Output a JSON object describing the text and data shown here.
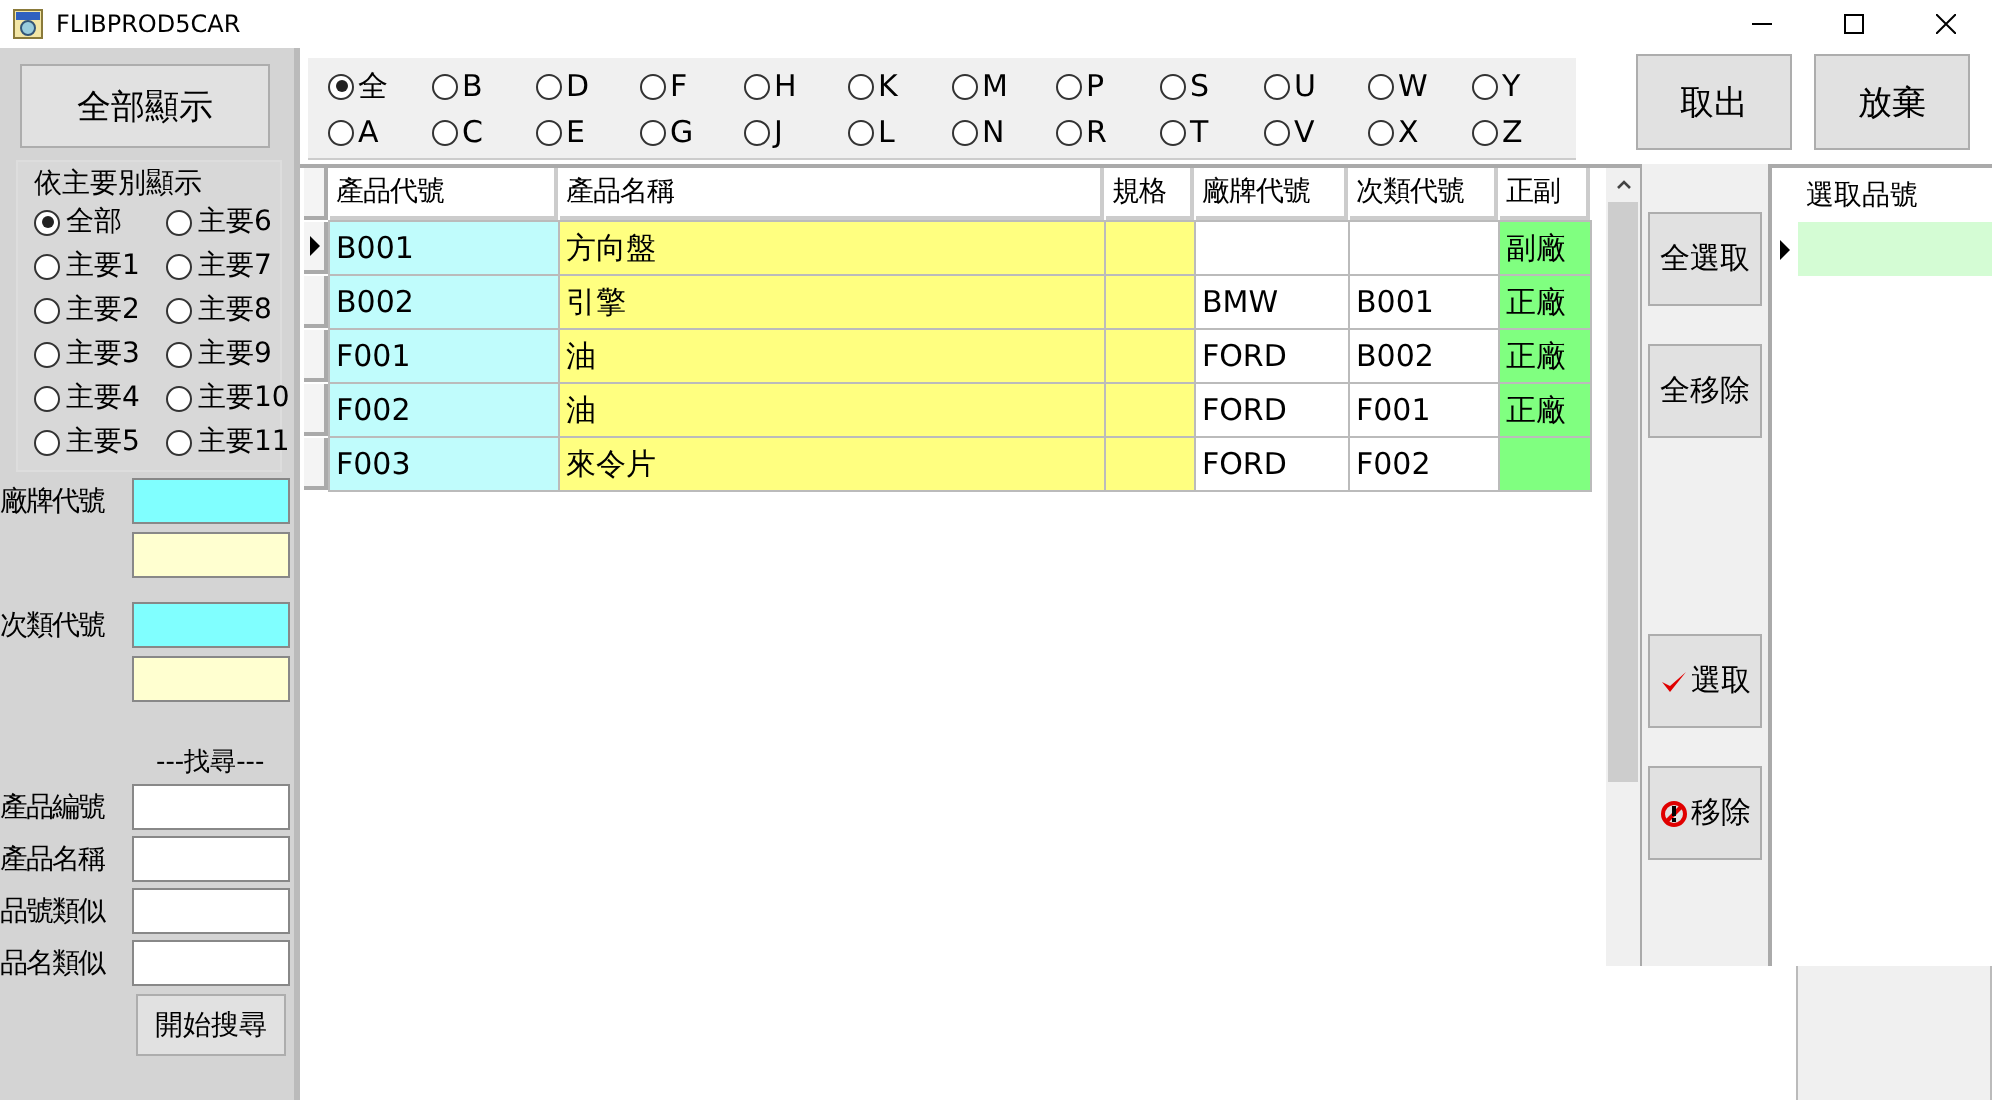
{
  "window": {
    "title": "FLIBPROD5CAR"
  },
  "left_panel": {
    "show_all_button": "全部顯示",
    "group_title": "依主要別顯示",
    "group_options": [
      {
        "label": "全部",
        "selected": true
      },
      {
        "label": "主要6",
        "selected": false
      },
      {
        "label": "主要1",
        "selected": false
      },
      {
        "label": "主要7",
        "selected": false
      },
      {
        "label": "主要2",
        "selected": false
      },
      {
        "label": "主要8",
        "selected": false
      },
      {
        "label": "主要3",
        "selected": false
      },
      {
        "label": "主要9",
        "selected": false
      },
      {
        "label": "主要4",
        "selected": false
      },
      {
        "label": "主要10",
        "selected": false
      },
      {
        "label": "主要5",
        "selected": false
      },
      {
        "label": "主要11",
        "selected": false
      }
    ],
    "brand_label": "廠牌代號",
    "subcategory_label": "次類代號",
    "search_title": "---找尋---",
    "search_fields": [
      {
        "label": "產品編號"
      },
      {
        "label": "產品名稱"
      },
      {
        "label": "品號類似"
      },
      {
        "label": "品名類似"
      }
    ],
    "search_button": "開始搜尋"
  },
  "letter_filter": [
    {
      "label": "全",
      "selected": true
    },
    {
      "label": "B",
      "selected": false
    },
    {
      "label": "D",
      "selected": false
    },
    {
      "label": "F",
      "selected": false
    },
    {
      "label": "H",
      "selected": false
    },
    {
      "label": "K",
      "selected": false
    },
    {
      "label": "M",
      "selected": false
    },
    {
      "label": "P",
      "selected": false
    },
    {
      "label": "S",
      "selected": false
    },
    {
      "label": "U",
      "selected": false
    },
    {
      "label": "W",
      "selected": false
    },
    {
      "label": "Y",
      "selected": false
    },
    {
      "label": "A",
      "selected": false
    },
    {
      "label": "C",
      "selected": false
    },
    {
      "label": "E",
      "selected": false
    },
    {
      "label": "G",
      "selected": false
    },
    {
      "label": "J",
      "selected": false
    },
    {
      "label": "L",
      "selected": false
    },
    {
      "label": "N",
      "selected": false
    },
    {
      "label": "R",
      "selected": false
    },
    {
      "label": "T",
      "selected": false
    },
    {
      "label": "V",
      "selected": false
    },
    {
      "label": "X",
      "selected": false
    },
    {
      "label": "Z",
      "selected": false
    }
  ],
  "top_buttons": [
    "取出",
    "放棄"
  ],
  "table": {
    "columns": [
      "產品代號",
      "產品名稱",
      "規格",
      "廠牌代號",
      "次類代號",
      "正副"
    ],
    "rows": [
      {
        "current": true,
        "cells": [
          "B001",
          "方向盤",
          null,
          null,
          null,
          "副廠"
        ]
      },
      {
        "current": false,
        "cells": [
          "B002",
          "引擎",
          null,
          "BMW",
          "B001",
          "正廠"
        ]
      },
      {
        "current": false,
        "cells": [
          "F001",
          "油",
          null,
          "FORD",
          "B002",
          "正廠"
        ]
      },
      {
        "current": false,
        "cells": [
          "F002",
          "油",
          null,
          "FORD",
          "F001",
          "正廠"
        ]
      },
      {
        "current": false,
        "cells": [
          "F003",
          "來令片",
          null,
          "FORD",
          "F002",
          null
        ]
      }
    ]
  },
  "action_buttons": [
    {
      "label": "全選取",
      "kind": "plain"
    },
    {
      "label": "全移除",
      "kind": "plain"
    },
    {
      "label": "選取",
      "kind": "check"
    },
    {
      "label": "移除",
      "kind": "remove"
    }
  ],
  "selected_table": {
    "columns": [
      "選取品號"
    ],
    "rows": [
      {
        "current": true
      }
    ]
  }
}
